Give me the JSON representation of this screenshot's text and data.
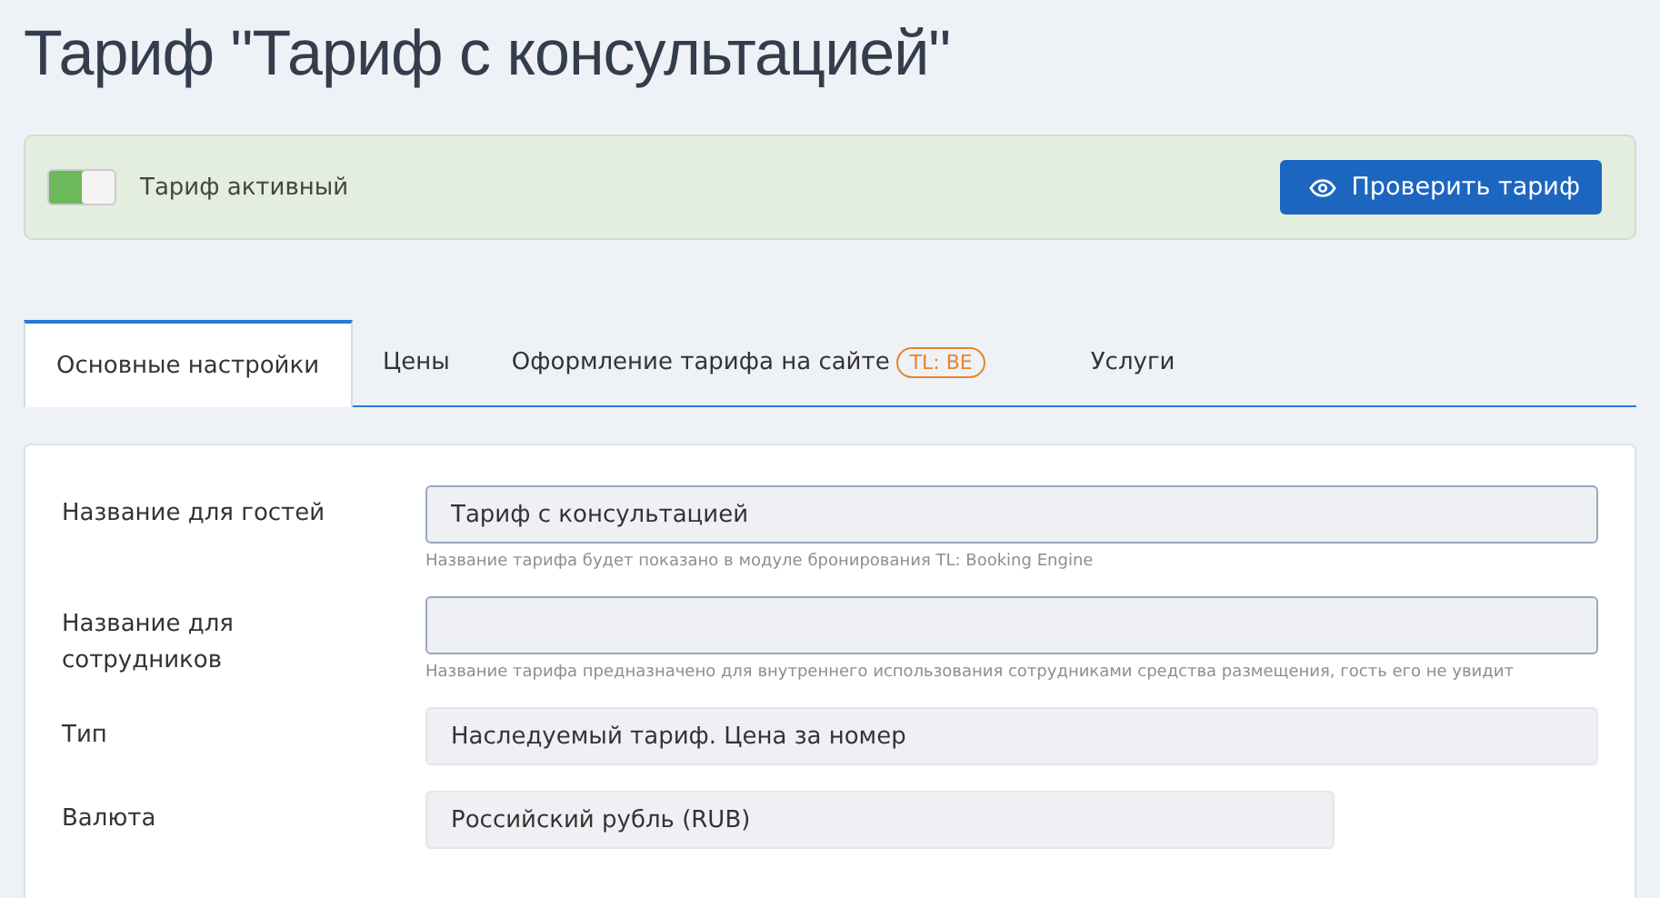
{
  "title": "Тариф \"Тариф с консультацией\"",
  "status_panel": {
    "toggle_on": true,
    "label": "Тариф активный",
    "button": "Проверить тариф"
  },
  "tabs": [
    {
      "label": "Основные настройки",
      "selected": true
    },
    {
      "label": "Цены",
      "selected": false
    },
    {
      "label": "Оформление тарифа на сайте",
      "badge": "TL: BE",
      "selected": false
    },
    {
      "label": "Услуги",
      "selected": false
    }
  ],
  "fields": [
    {
      "label": "Название для гостей",
      "kind": "input",
      "value": "Тариф с консультацией",
      "hint": "Название тарифа будет показано в модуле бронирования TL: Booking Engine"
    },
    {
      "label": "Название для сотрудников",
      "kind": "input",
      "hint": "Название тарифа предназначено для внутреннего использования сотрудниками средства размещения, гость его не увидит"
    },
    {
      "label": "Тип",
      "kind": "static",
      "value": "Наследуемый тариф. Цена за номер"
    },
    {
      "label": "Валюта",
      "kind": "static_short",
      "value": "Российский рубль (RUB)"
    }
  ]
}
